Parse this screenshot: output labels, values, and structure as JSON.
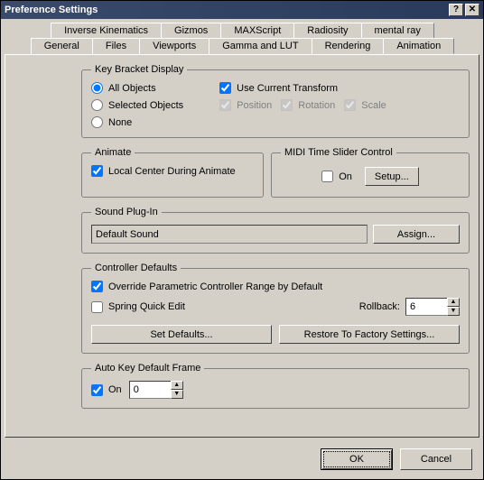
{
  "window": {
    "title": "Preference Settings"
  },
  "tabs": {
    "row1": [
      "Inverse Kinematics",
      "Gizmos",
      "MAXScript",
      "Radiosity",
      "mental ray"
    ],
    "row2": [
      "General",
      "Files",
      "Viewports",
      "Gamma and LUT",
      "Rendering",
      "Animation"
    ],
    "active": "Animation"
  },
  "keyBracket": {
    "legend": "Key Bracket Display",
    "radios": {
      "all": "All Objects",
      "selected": "Selected Objects",
      "none": "None"
    },
    "useCurrent": "Use Current Transform",
    "position": "Position",
    "rotation": "Rotation",
    "scale": "Scale"
  },
  "animate": {
    "legend": "Animate",
    "localCenter": "Local Center During Animate"
  },
  "midi": {
    "legend": "MIDI Time Slider Control",
    "on": "On",
    "setup": "Setup..."
  },
  "sound": {
    "legend": "Sound Plug-In",
    "value": "Default Sound",
    "assign": "Assign..."
  },
  "controller": {
    "legend": "Controller Defaults",
    "override": "Override Parametric Controller Range by Default",
    "spring": "Spring Quick Edit",
    "rollbackLabel": "Rollback:",
    "rollbackValue": "6",
    "setDefaults": "Set Defaults...",
    "restore": "Restore To Factory Settings..."
  },
  "autokey": {
    "legend": "Auto Key Default Frame",
    "on": "On",
    "value": "0"
  },
  "footer": {
    "ok": "OK",
    "cancel": "Cancel"
  }
}
